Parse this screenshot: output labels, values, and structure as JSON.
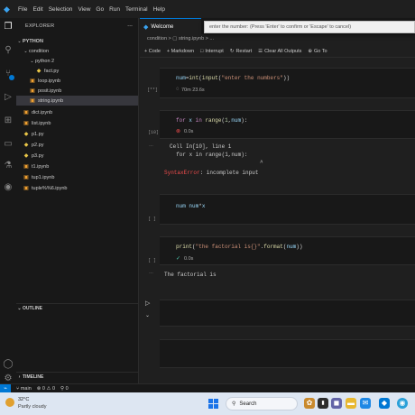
{
  "titlebar": {
    "logo_icon": "vscode-logo-icon",
    "menu": [
      "File",
      "Edit",
      "Selection",
      "View",
      "Go",
      "Run",
      "Terminal",
      "Help"
    ]
  },
  "quick_input": {
    "text": "enter the number: (Press 'Enter' to confirm or 'Escape' to cancel)"
  },
  "activity_bar": {
    "icons": [
      "explorer-icon",
      "search-icon",
      "source-control-icon",
      "run-debug-icon",
      "extensions-icon",
      "remote-explorer-icon",
      "testing-icon",
      "edge-icon",
      "accounts-icon",
      "manage-gear-icon"
    ]
  },
  "sidebar": {
    "title": "EXPLORER",
    "more": "...",
    "root": "PYTHON",
    "tree": [
      {
        "label": "condition",
        "type": "folder",
        "depth": 1,
        "expanded": true
      },
      {
        "label": "python 2",
        "type": "folder",
        "depth": 2,
        "expanded": true
      },
      {
        "label": "fact.py",
        "type": "py",
        "depth": 3
      },
      {
        "label": "loop.ipynb",
        "type": "ipynb",
        "depth": 2
      },
      {
        "label": "posit.ipynb",
        "type": "ipynb",
        "depth": 2
      },
      {
        "label": "string.ipynb",
        "type": "ipynb",
        "depth": 2,
        "selected": true
      },
      {
        "label": "dict.ipynb",
        "type": "ipynb",
        "depth": 1
      },
      {
        "label": "list.ipynb",
        "type": "ipynb",
        "depth": 1
      },
      {
        "label": "p1.py",
        "type": "py",
        "depth": 1
      },
      {
        "label": "p2.py",
        "type": "py",
        "depth": 1
      },
      {
        "label": "p3.py",
        "type": "py",
        "depth": 1
      },
      {
        "label": "t1.ipynb",
        "type": "ipynb",
        "depth": 1
      },
      {
        "label": "tup1.ipynb",
        "type": "ipynb",
        "depth": 1
      },
      {
        "label": "tuple%%6.ipynb",
        "type": "ipynb",
        "depth": 1
      }
    ],
    "outline": "OUTLINE",
    "timeline": "TIMELINE"
  },
  "editor": {
    "tab_label": "Welcome",
    "breadcrumb": "condition > ▢ string.ipynb > ...",
    "toolbar": [
      "+ Code",
      "+ Markdown",
      "Interrupt",
      "Restart",
      "Clear All Outputs",
      "Go To"
    ],
    "cells": [
      {
        "exec": "[**]",
        "status_icon": "spinner-icon",
        "time": "70m 23.6s"
      },
      {
        "exec": "[10]",
        "status_icon": "error-icon",
        "time": "0.0s",
        "out_line1": "Cell In[10], line 1",
        "out_line2": "  for x in range(1,num):",
        "out_caret": "^",
        "err_name": "SyntaxError",
        "err_msg": ": incomplete input"
      },
      {
        "exec": "[ ]"
      },
      {
        "exec": "[ ]",
        "status_icon": "check-icon",
        "time": "0.0s",
        "output": "The factorial is"
      },
      {
        "exec": ""
      },
      {
        "exec": ""
      }
    ]
  },
  "statusbar": {
    "branch": "main",
    "errors": "⊗ 0 ⚠ 0",
    "ports": "⚲ 0"
  },
  "taskbar": {
    "weather_temp": "32°C",
    "weather_desc": "Partly cloudy",
    "search": "Search"
  }
}
